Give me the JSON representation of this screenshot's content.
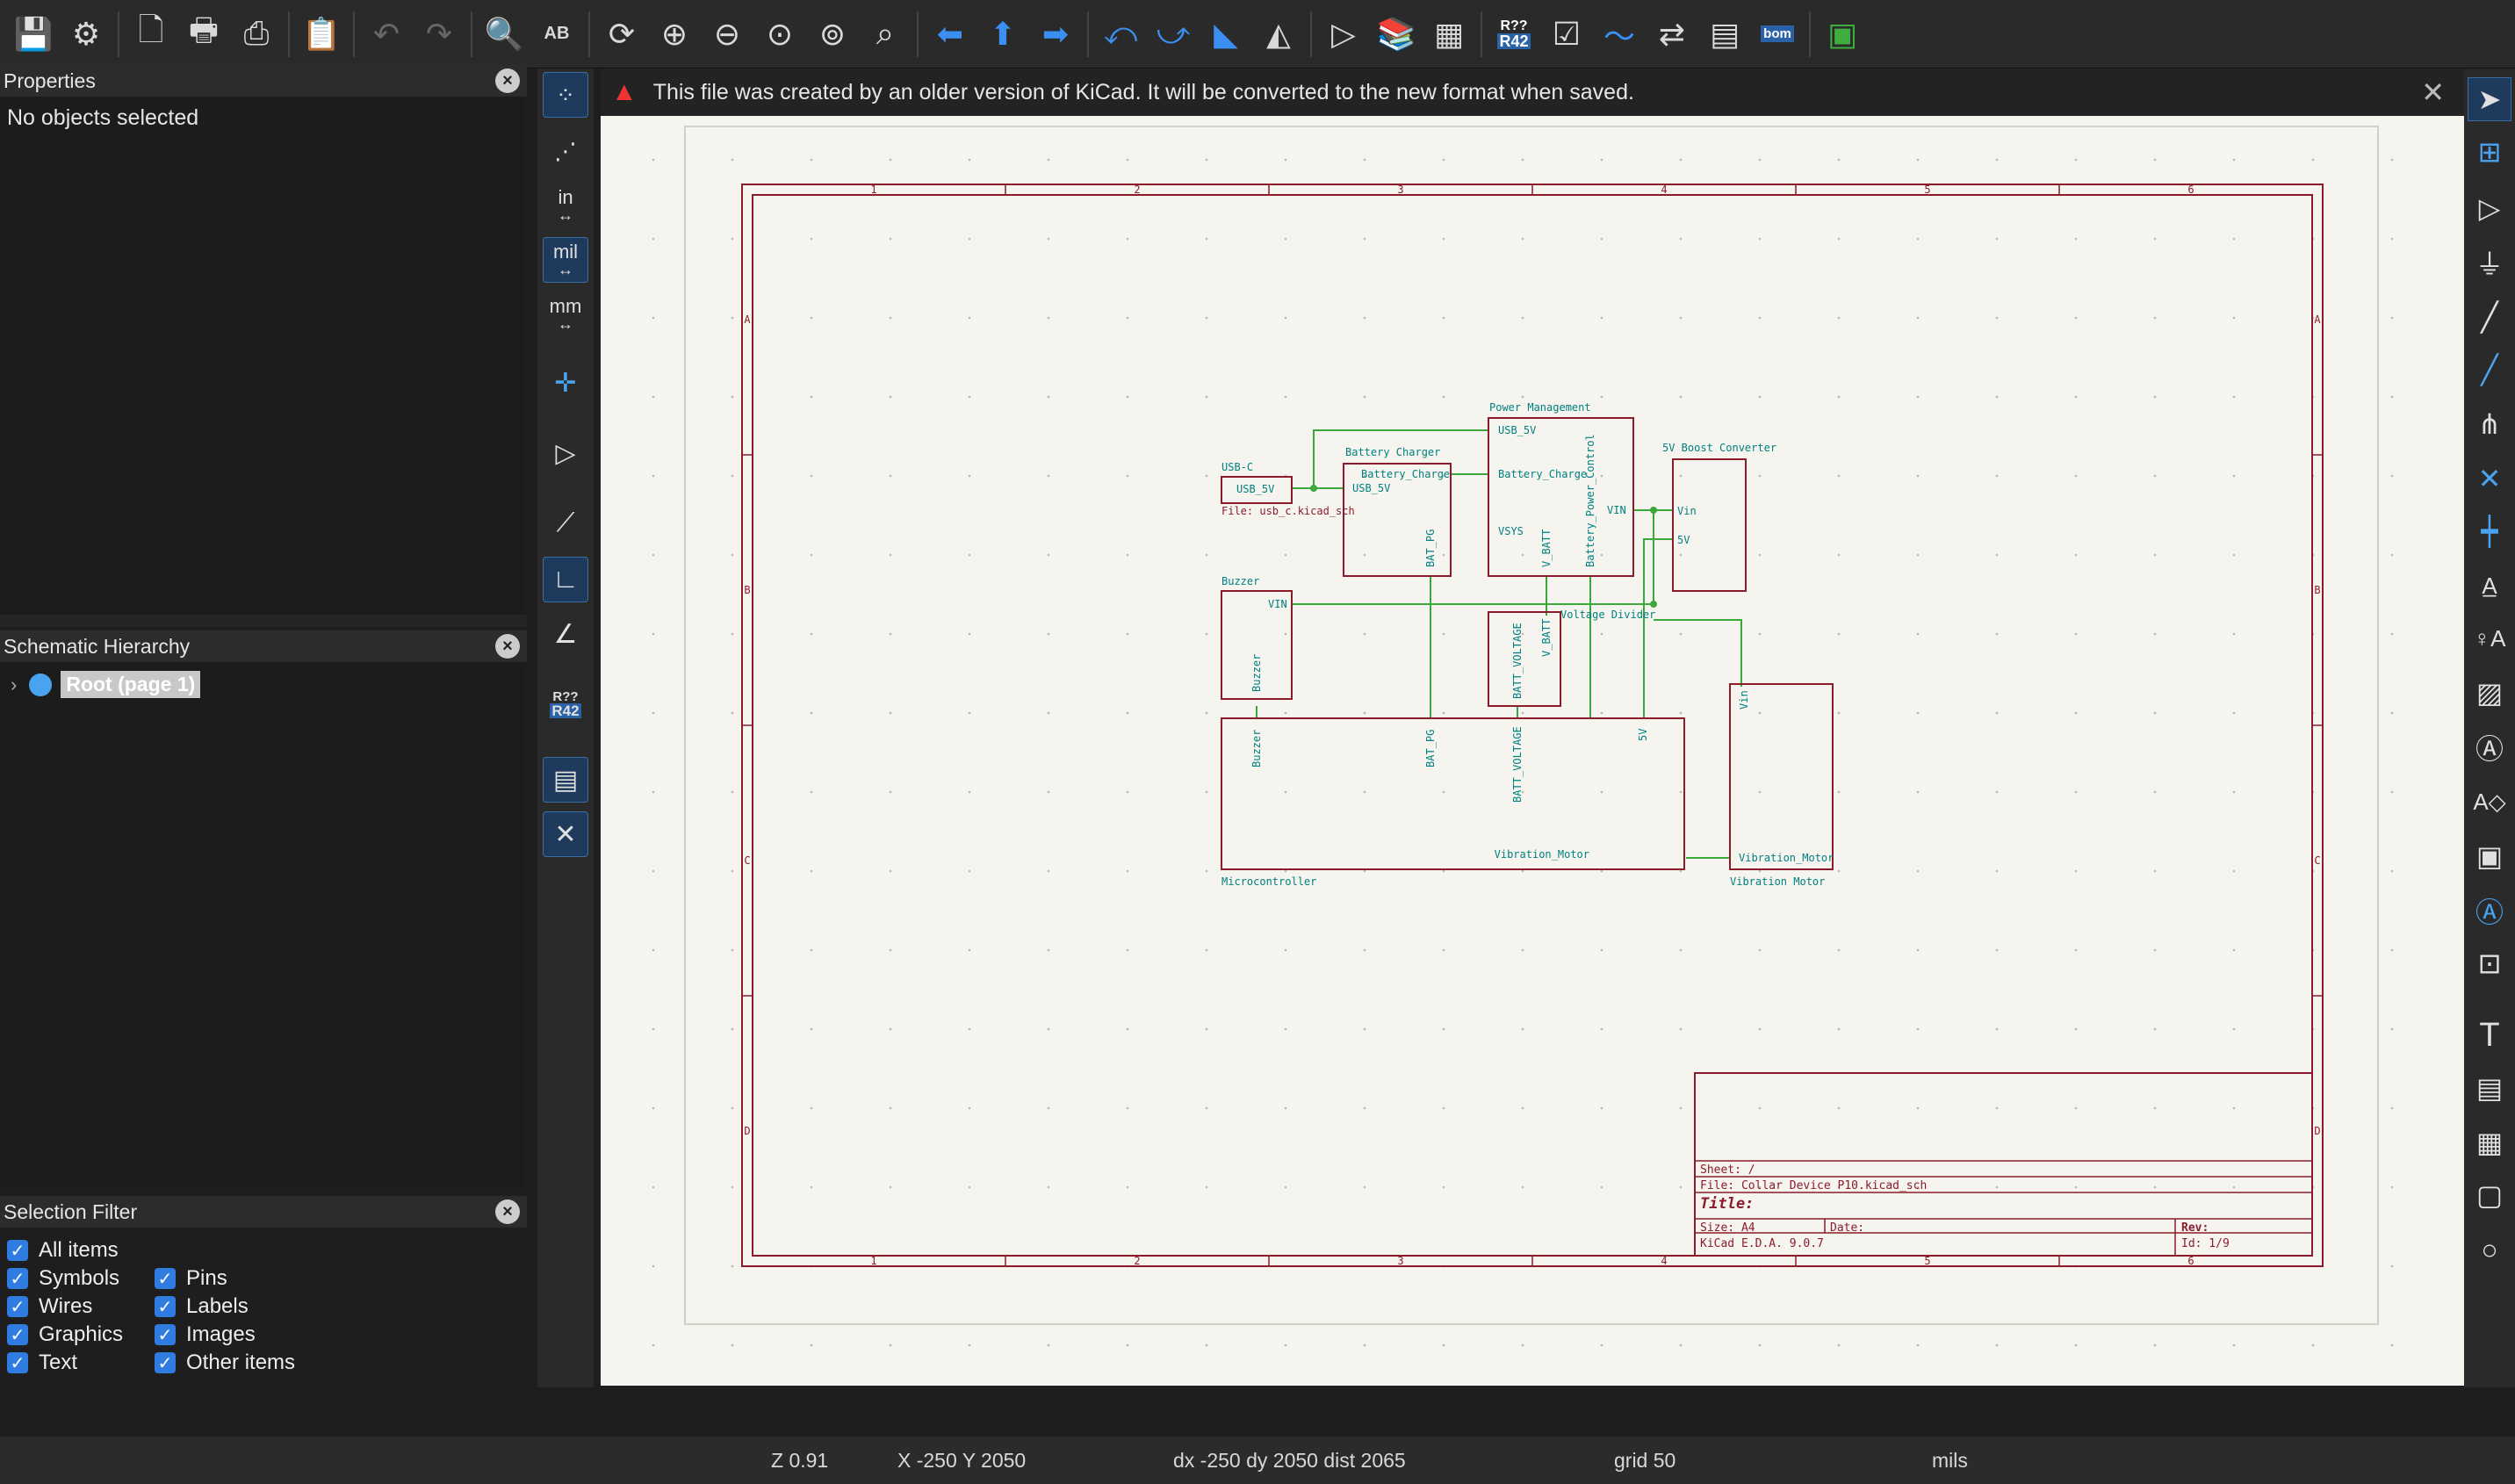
{
  "toolbar": {
    "icons": [
      "save-icon",
      "schematic-setup-icon",
      "page-settings-icon",
      "print-icon",
      "plot-icon",
      "paste-icon",
      "undo-icon",
      "redo-icon",
      "find-icon",
      "find-replace-icon",
      "refresh-icon",
      "zoom-in-icon",
      "zoom-out-icon",
      "zoom-fit-icon",
      "zoom-objects-icon",
      "zoom-selection-icon",
      "navigate-back-icon",
      "navigate-up-icon",
      "navigate-forward-icon",
      "rotate-ccw-icon",
      "rotate-cw-icon",
      "mirror-vertical-icon",
      "mirror-horizontal-icon",
      "symbol-editor-icon",
      "symbol-library-icon",
      "symbol-fields-icon",
      "annotate-icon",
      "erc-icon",
      "simulator-icon",
      "footprint-assign-icon",
      "bom-table-icon",
      "bom-export-icon",
      "pcb-editor-icon"
    ],
    "annotate_label_top": "R??",
    "annotate_label_bottom": "R42",
    "bom_label": "bom"
  },
  "properties": {
    "title": "Properties",
    "empty_text": "No objects selected"
  },
  "hierarchy": {
    "title": "Schematic Hierarchy",
    "root_label": "Root (page 1)"
  },
  "selection_filter": {
    "title": "Selection Filter",
    "items": [
      {
        "label": "All items",
        "checked": true
      },
      {
        "label": "Symbols",
        "checked": true
      },
      {
        "label": "Pins",
        "checked": true
      },
      {
        "label": "Wires",
        "checked": true
      },
      {
        "label": "Labels",
        "checked": true
      },
      {
        "label": "Graphics",
        "checked": true
      },
      {
        "label": "Images",
        "checked": true
      },
      {
        "label": "Text",
        "checked": true
      },
      {
        "label": "Other items",
        "checked": true
      }
    ]
  },
  "left_tools": {
    "unit_in": "in",
    "unit_mil": "mil",
    "unit_mm": "mm",
    "annotate_top": "R??",
    "annotate_bottom": "R42"
  },
  "banner": {
    "message": "This file was created by an older version of KiCad. It will be converted to the new format when saved."
  },
  "schematic": {
    "column_numbers": [
      "1",
      "2",
      "3",
      "4",
      "5",
      "6"
    ],
    "row_letters": [
      "A",
      "B",
      "C",
      "D"
    ],
    "sheets": {
      "usbc": {
        "name": "USB-C",
        "file": "File: usb_c.kicad_sch",
        "pin": "USB_5V"
      },
      "charger": {
        "name": "Battery Charger",
        "pin_usb": "USB_5V",
        "pin_charge": "Battery_Charge",
        "pin_pg": "BAT_PG"
      },
      "power": {
        "name": "Power Management",
        "pin_usb": "USB_5V",
        "pin_charge": "Battery_Charge",
        "pin_vsys": "VSYS",
        "pin_vbat": "V_BATT",
        "pin_ctrl": "Battery_Power_Control",
        "pin_vin": "VIN"
      },
      "boost": {
        "name": "5V Boost Converter",
        "pin_vin": "Vin",
        "pin_5v": "5V"
      },
      "buzzer": {
        "name": "Buzzer",
        "pin_vin": "VIN",
        "pin_buzzer": "Buzzer"
      },
      "divider": {
        "name": "Voltage Divider",
        "pin_vbat": "V_BATT",
        "pin_volt": "BATT_VOLTAGE"
      },
      "mcu": {
        "name": "Microcontroller",
        "pin_buzzer": "Buzzer",
        "pin_pg": "BAT_PG",
        "pin_volt": "BATT_VOLTAGE",
        "pin_5v": "5V",
        "pin_vib": "Vibration_Motor"
      },
      "motor": {
        "name": "Vibration Motor",
        "pin_vin": "Vin",
        "pin_vib": "Vibration_Motor"
      }
    },
    "title_block": {
      "sheet": "Sheet: /",
      "file": "File: Collar Device P10.kicad_sch",
      "title": "Title:",
      "size": "Size: A4",
      "date": "Date:",
      "rev": "Rev:",
      "app": "KiCad E.D.A. 9.0.7",
      "id": "Id: 1/9"
    }
  },
  "status": {
    "zoom": "Z 0.91",
    "coords": "X -250  Y 2050",
    "delta": "dx -250  dy 2050  dist 2065",
    "grid": "grid 50",
    "units": "mils"
  }
}
